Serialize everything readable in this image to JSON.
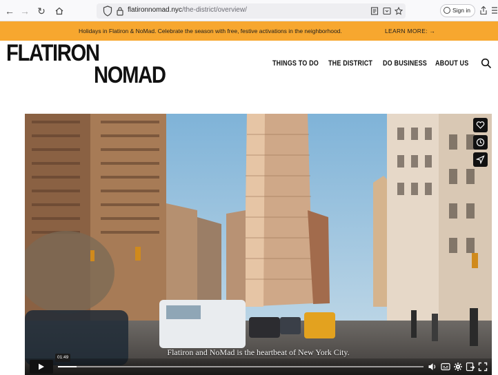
{
  "browser": {
    "url_domain": "flatironnomad.nyc",
    "url_path": "/the-district/overview/",
    "signin_label": "Sign in"
  },
  "banner": {
    "text": "Holidays in Flatiron & NoMad. Celebrate the season with free, festive activations in the neighborhood.",
    "link_label": "LEARN MORE: →",
    "color": "#f7a72f"
  },
  "header": {
    "logo_line1": "FLATIRON",
    "logo_line2": "NOMAD",
    "nav": [
      {
        "label": "THINGS TO DO"
      },
      {
        "label": "THE DISTRICT"
      },
      {
        "label": "DO BUSINESS"
      },
      {
        "label": "ABOUT US"
      }
    ],
    "search_icon": "search-icon"
  },
  "video": {
    "caption": "Flatiron and NoMad is the heartbeat of New York City.",
    "timestamp": "01:49",
    "progress": 0.05,
    "side_actions": [
      "heart-icon",
      "clock-icon",
      "send-icon"
    ],
    "control_icons": [
      "volume-icon",
      "captions-icon",
      "settings-icon",
      "share-icon",
      "fullscreen-icon"
    ]
  }
}
